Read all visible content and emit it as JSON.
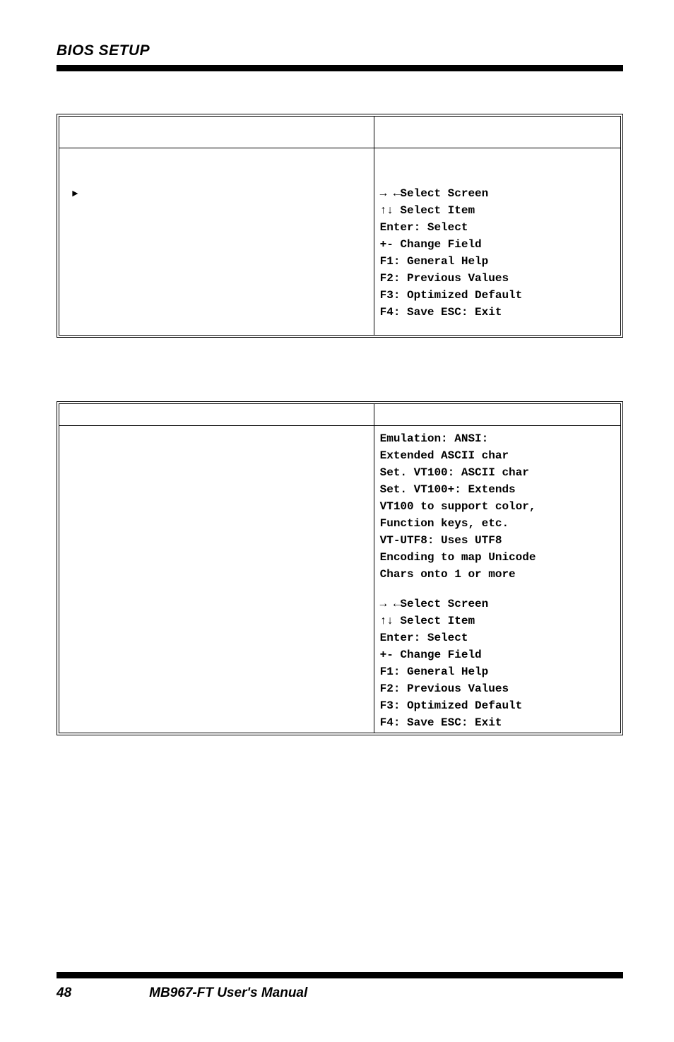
{
  "page_title": "BIOS SETUP",
  "table1": {
    "marker": "►",
    "nav1": "→ ←Select Screen",
    "nav2": "↑↓ Select Item",
    "nav3": "Enter: Select",
    "nav4": "+-  Change Field",
    "nav5": "F1: General Help",
    "nav6": "F2: Previous Values",
    "nav7": "F3: Optimized Default",
    "nav8": "F4: Save  ESC: Exit"
  },
  "table2": {
    "desc1": "Emulation: ANSI:",
    "desc2": "Extended ASCII char",
    "desc3": "Set. VT100: ASCII char",
    "desc4": "Set. VT100+: Extends",
    "desc5": "VT100 to support color,",
    "desc6": "Function keys, etc.",
    "desc7": "VT-UTF8: Uses UTF8",
    "desc8": "Encoding to map Unicode",
    "desc9": "Chars onto 1 or more",
    "nav1": "→ ←Select Screen",
    "nav2": "↑↓ Select Item",
    "nav3": "Enter: Select",
    "nav4": "+-  Change Field",
    "nav5": "F1: General Help",
    "nav6": "F2: Previous Values",
    "nav7": "F3: Optimized Default",
    "nav8": "F4: Save  ESC: Exit"
  },
  "footer": {
    "page_number": "48",
    "manual_title": "MB967-FT User's Manual"
  }
}
